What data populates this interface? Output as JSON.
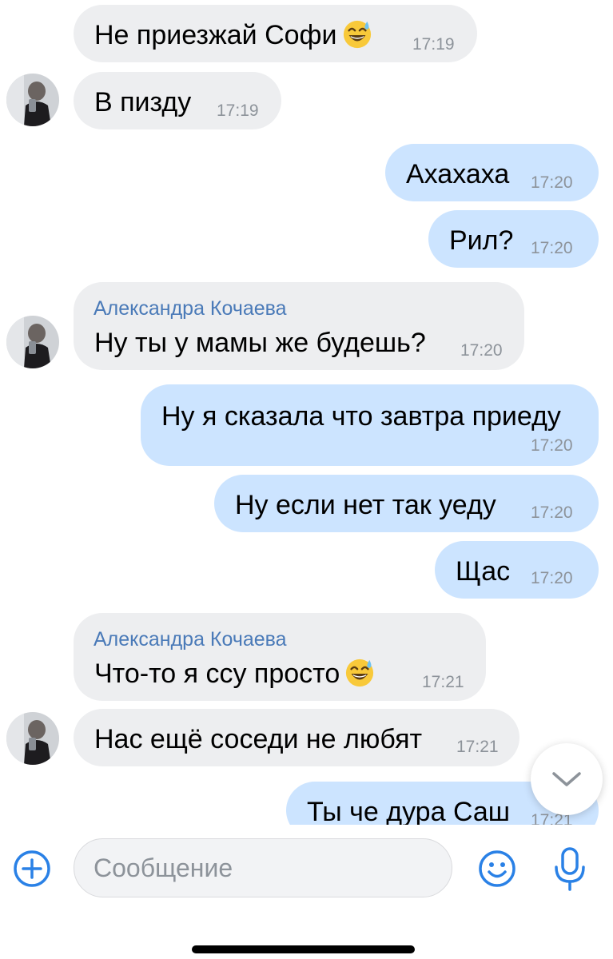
{
  "messages": [
    {
      "direction": "in",
      "text": "Не приезжай Софи",
      "emoji": "sweat-smile",
      "time": "17:19"
    },
    {
      "direction": "in",
      "text": "В пизду",
      "time": "17:19"
    },
    {
      "direction": "out",
      "text": "Ахахаха",
      "time": "17:20"
    },
    {
      "direction": "out",
      "text": "Рил?",
      "time": "17:20"
    },
    {
      "direction": "in",
      "sender": "Александра Кочаева",
      "text": "Ну ты у мамы же будешь?",
      "time": "17:20"
    },
    {
      "direction": "out",
      "text": "Ну я сказала что завтра приеду",
      "time": "17:20"
    },
    {
      "direction": "out",
      "text": "Ну если нет так уеду",
      "time": "17:20"
    },
    {
      "direction": "out",
      "text": "Щас",
      "time": "17:20"
    },
    {
      "direction": "in",
      "sender": "Александра Кочаева",
      "text": "Что-то я ссу просто",
      "emoji": "sweat-smile",
      "time": "17:21"
    },
    {
      "direction": "in",
      "text": "Нас ещё соседи не любят",
      "time": "17:21"
    },
    {
      "direction": "out",
      "text": "Ты че дура Саш",
      "time": "17:21"
    }
  ],
  "composer": {
    "placeholder": "Сообщение"
  },
  "icons": {
    "attach": "plus-circle-icon",
    "emoji": "smiley-icon",
    "voice": "microphone-icon",
    "scroll": "chevron-down-icon"
  },
  "colors": {
    "incoming_bubble": "#edeef0",
    "outgoing_bubble": "#cce4ff",
    "sender_name": "#4a7ab8",
    "timestamp": "#8d939a",
    "accent": "#2a81e6"
  }
}
